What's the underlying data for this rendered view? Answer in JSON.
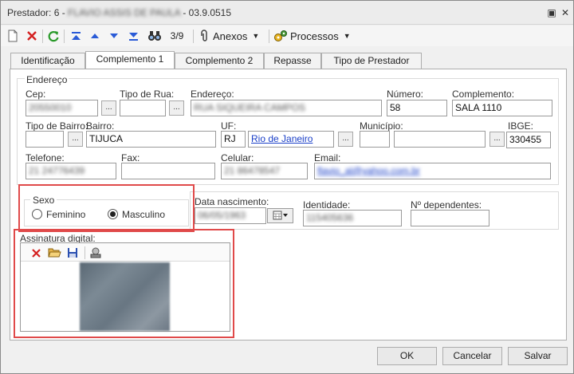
{
  "window": {
    "title_prefix": "Prestador: 6 - ",
    "title_name": "FLAVIO ASSIS DE PAULA",
    "title_suffix": " - 03.9.0515"
  },
  "toolbar": {
    "record_position": "3/9",
    "anexos_label": "Anexos",
    "processos_label": "Processos"
  },
  "tabs": [
    {
      "label": "Identificação",
      "active": false
    },
    {
      "label": "Complemento 1",
      "active": true
    },
    {
      "label": "Complemento 2",
      "active": false
    },
    {
      "label": "Repasse",
      "active": false
    },
    {
      "label": "Tipo de Prestador",
      "active": false
    }
  ],
  "endereco": {
    "group_label": "Endereço",
    "cep_label": "Cep:",
    "cep_value": "20550010",
    "tipo_rua_label": "Tipo de Rua:",
    "tipo_rua_value": "",
    "endereco_label": "Endereço:",
    "endereco_value": "RUA SIQUEIRA CAMPOS",
    "numero_label": "Número:",
    "numero_value": "58",
    "complemento_label": "Complemento:",
    "complemento_value": "SALA 1110",
    "tipo_bairro_label": "Tipo de Bairro:",
    "tipo_bairro_value": "",
    "bairro_label": "Bairro:",
    "bairro_value": "TIJUCA",
    "uf_label": "UF:",
    "uf_value": "RJ",
    "uf_name": "Rio de Janeiro",
    "municipio_label": "Município:",
    "municipio_code": "",
    "municipio_value": "",
    "ibge_label": "IBGE:",
    "ibge_value": "330455",
    "telefone_label": "Telefone:",
    "telefone_value": "21 24776439",
    "fax_label": "Fax:",
    "fax_value": "",
    "celular_label": "Celular:",
    "celular_value": "21 86478547",
    "email_label": "Email:",
    "email_value": "flavio_al@yahoo.com.br"
  },
  "sexo": {
    "group_label": "Sexo",
    "options": [
      "Feminino",
      "Masculino"
    ],
    "selected": "Masculino"
  },
  "dados": {
    "data_nascimento_label": "Data nascimento:",
    "data_nascimento_value": "06/05/1963",
    "identidade_label": "Identidade:",
    "identidade_value": "115405636",
    "dependentes_label": "Nº dependentes:",
    "dependentes_value": ""
  },
  "assinatura": {
    "label": "Assinatura digital:"
  },
  "buttons": {
    "ok": "OK",
    "cancelar": "Cancelar",
    "salvar": "Salvar"
  },
  "colors": {
    "highlight_border": "#e04a4a",
    "link": "#1a3fc8",
    "delete_red": "#d42020"
  }
}
